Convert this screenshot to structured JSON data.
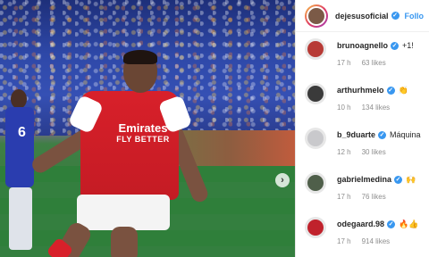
{
  "post": {
    "header": {
      "username": "dejesusoficial",
      "verified_mark": "✓",
      "follow_label": "Follo"
    },
    "photo": {
      "jersey_sponsor_line1": "Emirates",
      "jersey_sponsor_line2": "FLY BETTER",
      "background_player_number": "6",
      "next_arrow": "›"
    },
    "comments": [
      {
        "username": "brunoagnello",
        "verified_mark": "✓",
        "text": "+1!",
        "time": "17 h",
        "likes": "63 likes",
        "avatar_color": "#b73a35"
      },
      {
        "username": "arthurhmelo",
        "verified_mark": "✓",
        "text": "👏",
        "time": "10 h",
        "likes": "134 likes",
        "avatar_color": "#3a3a3a"
      },
      {
        "username": "b_9duarte",
        "verified_mark": "✓",
        "text": "Máquina",
        "time": "12 h",
        "likes": "30 likes",
        "avatar_color": "#c9c9cc"
      },
      {
        "username": "gabrielmedina",
        "verified_mark": "✓",
        "text": "🙌",
        "time": "17 h",
        "likes": "76 likes",
        "avatar_color": "#4f5f4a"
      },
      {
        "username": "odegaard.98",
        "verified_mark": "✓",
        "text": "🔥👍",
        "time": "17 h",
        "likes": "914 likes",
        "avatar_color": "#c0222c"
      }
    ]
  },
  "colors": {
    "link_blue": "#3897f0",
    "arsenal_red": "#d8202a",
    "pitch_green": "#2f7f3a"
  }
}
